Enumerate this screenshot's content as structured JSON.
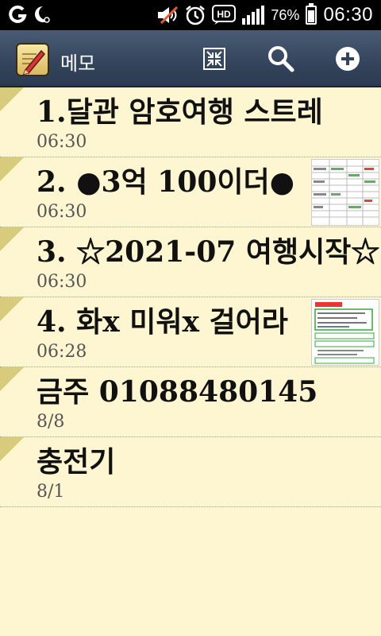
{
  "status_bar": {
    "battery_percent": "76%",
    "time": "06:30",
    "icons": [
      "g-icon",
      "moon-icon",
      "muted-speaker-icon",
      "alarm-icon",
      "hd-icon",
      "signal-icon",
      "battery-icon"
    ]
  },
  "action_bar": {
    "title": "메모",
    "buttons": [
      "compress-view-icon",
      "search-icon",
      "add-icon"
    ]
  },
  "memos": [
    {
      "title": "1.달관 암호여행 스트레",
      "date": "06:30",
      "has_thumbnail": false
    },
    {
      "title": "2. ●3억 100이더●",
      "date": "06:30",
      "has_thumbnail": true
    },
    {
      "title": "3. ☆2021-07 여행시작☆",
      "date": "06:30",
      "has_thumbnail": false
    },
    {
      "title": "4. 화x 미워x 걸어라",
      "date": "06:28",
      "has_thumbnail": true
    },
    {
      "title": "금주 01088480145",
      "date": "8/8",
      "has_thumbnail": false
    },
    {
      "title": "충전기",
      "date": "8/1",
      "has_thumbnail": false
    }
  ],
  "colors": {
    "background": "#fdf6d0",
    "action_bar": "#33445c",
    "corner_fold": "#d8cb7c"
  }
}
